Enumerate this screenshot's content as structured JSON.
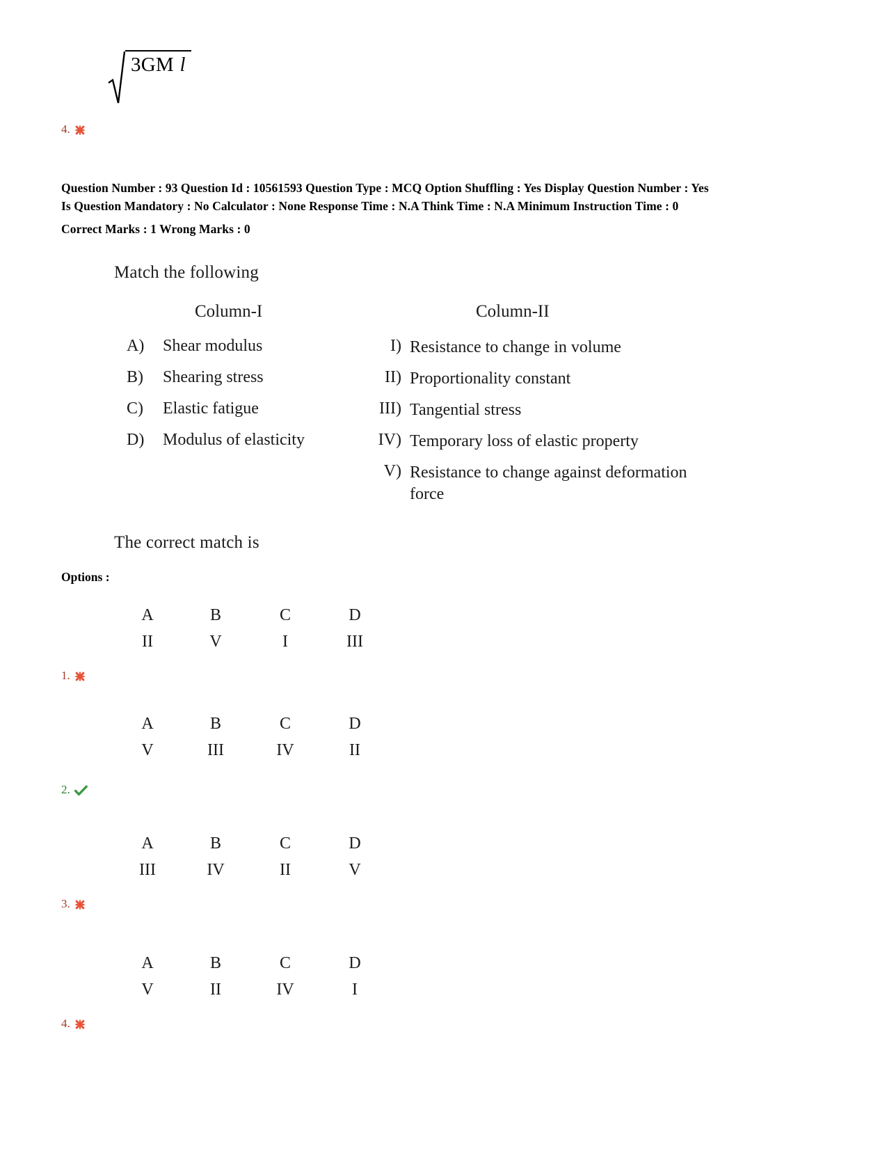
{
  "top_formula": {
    "radicand_numerator": "3GM",
    "radicand_denominator": "l",
    "marker": {
      "number": "4.",
      "icon": "cross-icon",
      "state": "wrong",
      "color": "#a33b2a"
    }
  },
  "metadata": {
    "line1": "Question Number : 93 Question Id : 10561593 Question Type : MCQ Option Shuffling : Yes Display Question Number : Yes",
    "line2": "Is Question Mandatory : No Calculator : None Response Time : N.A Think Time : N.A Minimum Instruction Time : 0",
    "line3": "Correct Marks : 1 Wrong Marks : 0"
  },
  "question": {
    "prompt": "Match the following",
    "column1_header": "Column-I",
    "column2_header": "Column-II",
    "column1": [
      {
        "key": "A)",
        "text": "Shear modulus"
      },
      {
        "key": "B)",
        "text": "Shearing stress"
      },
      {
        "key": "C)",
        "text": "Elastic fatigue"
      },
      {
        "key": "D)",
        "text": "Modulus of elasticity"
      }
    ],
    "column2": [
      {
        "key": "I)",
        "text": "Resistance to change in volume"
      },
      {
        "key": "II)",
        "text": "Proportionality constant"
      },
      {
        "key": "III)",
        "text": "Tangential stress"
      },
      {
        "key": "IV)",
        "text": "Temporary loss of elastic property"
      },
      {
        "key": "V)",
        "text": "Resistance to change against deformation force"
      }
    ],
    "closing": "The correct match is"
  },
  "options_label": "Options :",
  "options": [
    {
      "number": "1.",
      "icon": "cross-icon",
      "state": "wrong",
      "color": "#a33b2a",
      "headers": [
        "A",
        "B",
        "C",
        "D"
      ],
      "values": [
        "II",
        "V",
        "I",
        "III"
      ]
    },
    {
      "number": "2.",
      "icon": "check-icon",
      "state": "correct",
      "color": "#2f7d32",
      "headers": [
        "A",
        "B",
        "C",
        "D"
      ],
      "values": [
        "V",
        "III",
        "IV",
        "II"
      ]
    },
    {
      "number": "3.",
      "icon": "cross-icon",
      "state": "wrong",
      "color": "#a33b2a",
      "headers": [
        "A",
        "B",
        "C",
        "D"
      ],
      "values": [
        "III",
        "IV",
        "II",
        "V"
      ]
    },
    {
      "number": "4.",
      "icon": "cross-icon",
      "state": "wrong",
      "color": "#a33b2a",
      "headers": [
        "A",
        "B",
        "C",
        "D"
      ],
      "values": [
        "V",
        "II",
        "IV",
        "I"
      ]
    }
  ]
}
